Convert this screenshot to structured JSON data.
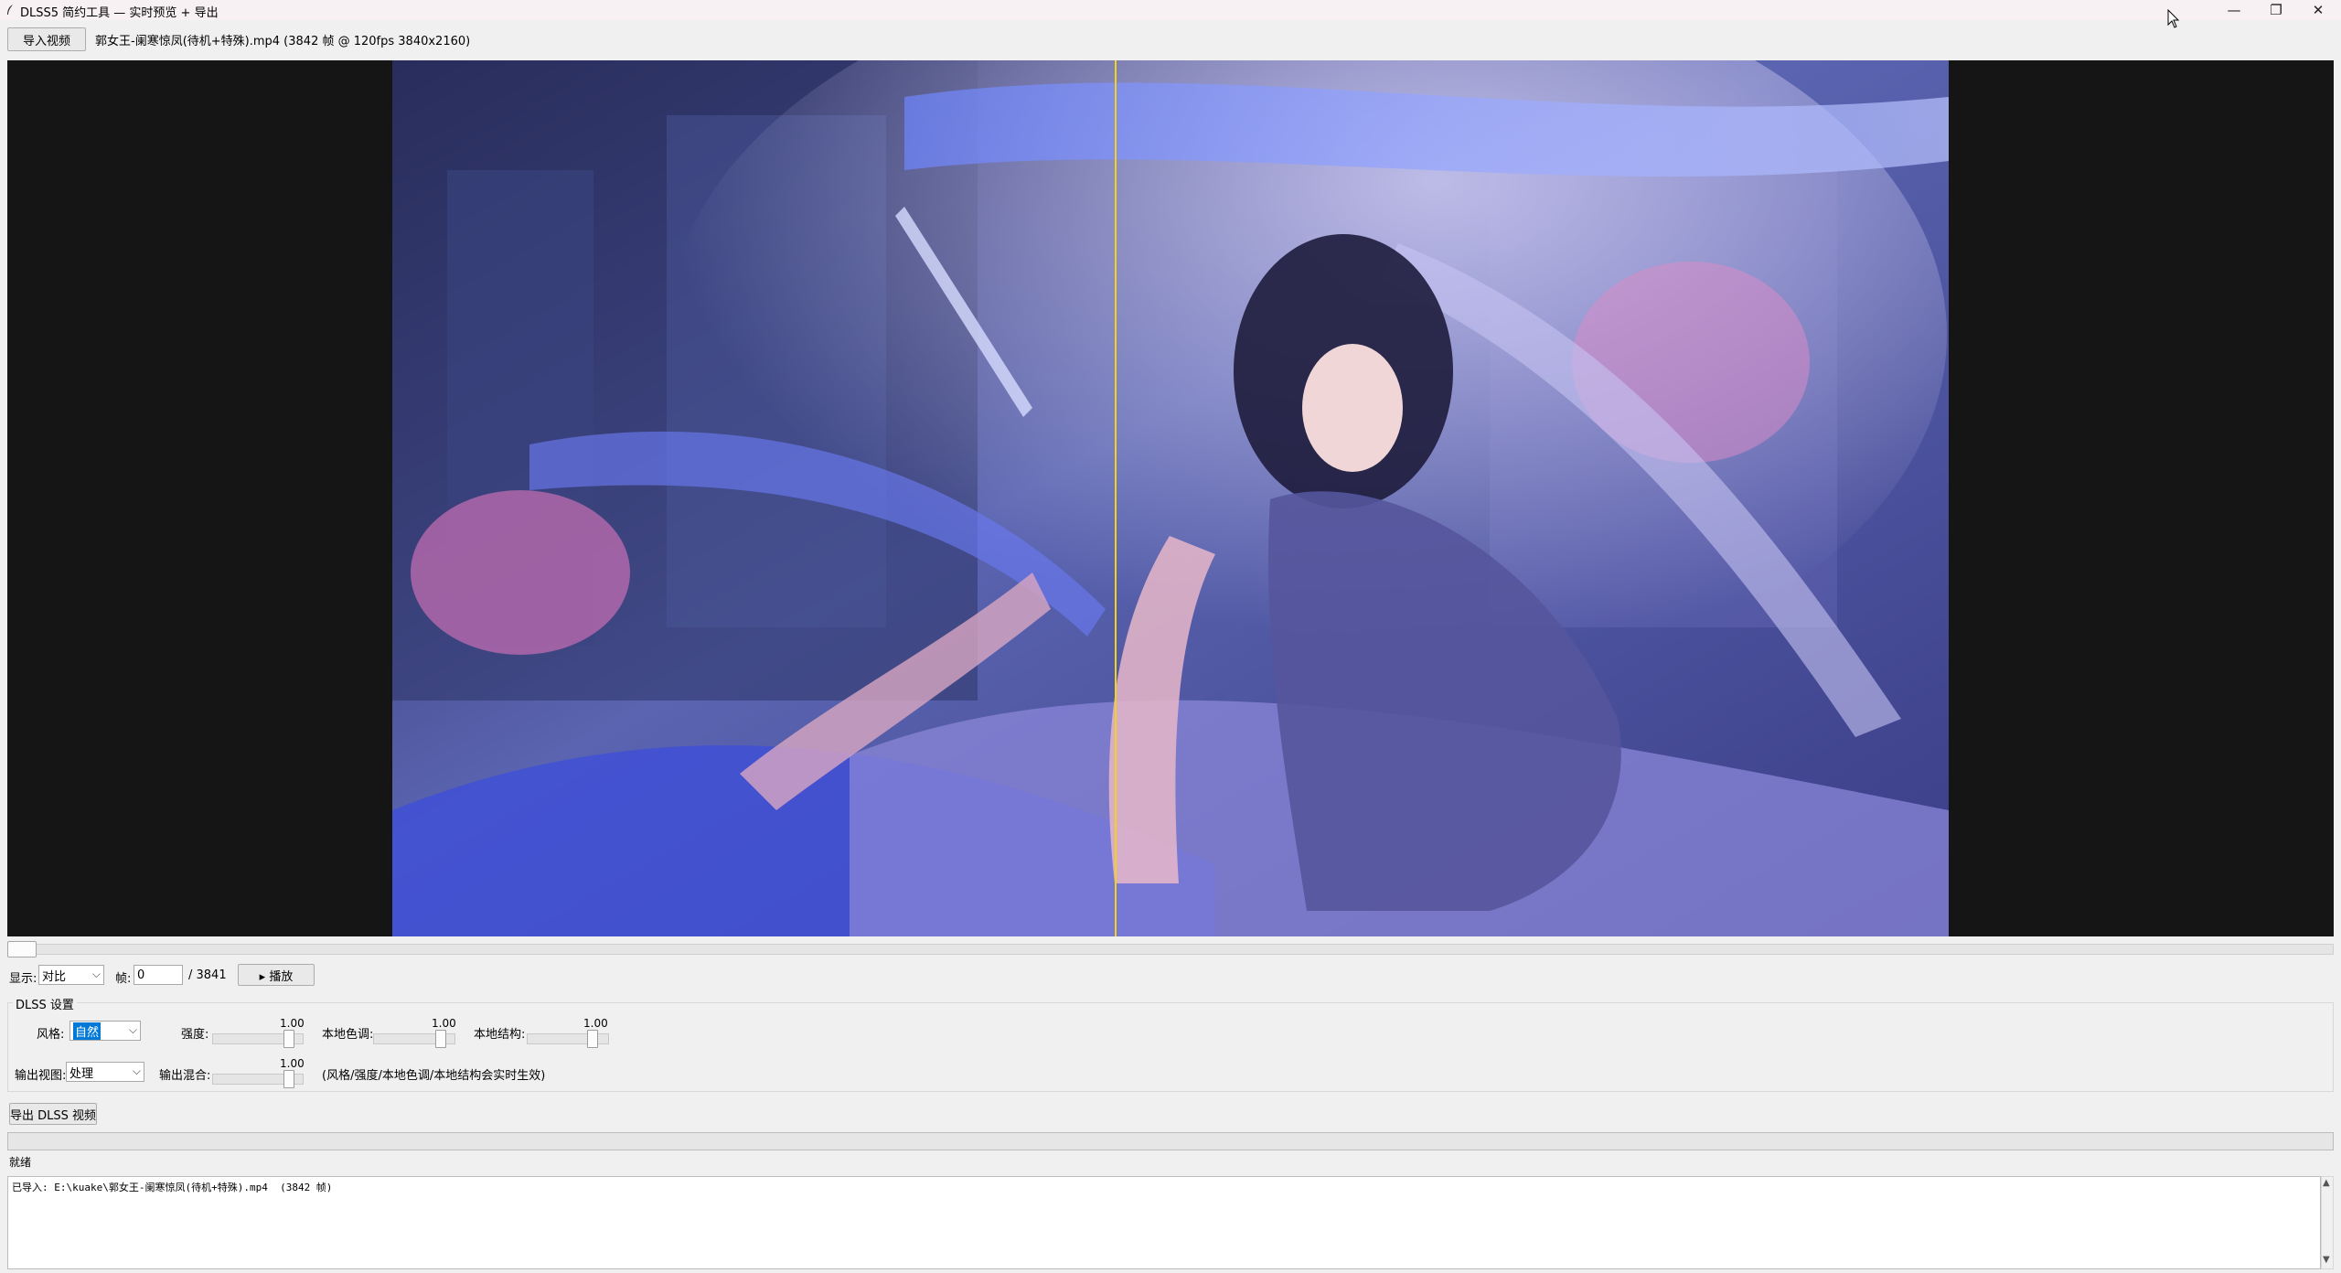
{
  "window": {
    "title": "DLSS5 简约工具 — 实时预览 + 导出",
    "minimize_glyph": "—",
    "maximize_glyph": "❐",
    "close_glyph": "✕"
  },
  "toolbar": {
    "import_label": "导入视频",
    "file_info": "郭女王-阑寒惊凤(待机+特殊).mp4  (3842 帧 @ 120fps 3840x2160)"
  },
  "controls": {
    "display_label": "显示:",
    "display_value": "对比",
    "frame_label": "帧:",
    "frame_value": "0",
    "frame_total": "/ 3841",
    "play_label": "▸ 播放",
    "timeline_position": 0.0
  },
  "dlss": {
    "group_title": "DLSS 设置",
    "style_label": "风格:",
    "style_value": "自然",
    "strength_label": "强度:",
    "strength_value": "1.00",
    "local_tone_label": "本地色调:",
    "local_tone_value": "1.00",
    "local_struct_label": "本地结构:",
    "local_struct_value": "1.00",
    "output_view_label": "输出视图:",
    "output_view_value": "处理",
    "output_mix_label": "输出混合:",
    "output_mix_value": "1.00",
    "hint": "(风格/强度/本地色调/本地结构会实时生效)"
  },
  "export": {
    "export_label": "导出 DLSS 视频",
    "progress": 0.0
  },
  "status": {
    "text": "就绪",
    "log": "已导入: E:\\kuake\\郭女王-阑寒惊凤(待机+特殊).mp4  (3842 帧)"
  },
  "icons": {
    "app": "feather-icon",
    "cursor": "mouse-cursor-icon",
    "dropdown": "chevron-down-icon"
  },
  "colors": {
    "divider": "#f2d21b",
    "selection": "#0078d7",
    "preview_bg": "#151515"
  }
}
